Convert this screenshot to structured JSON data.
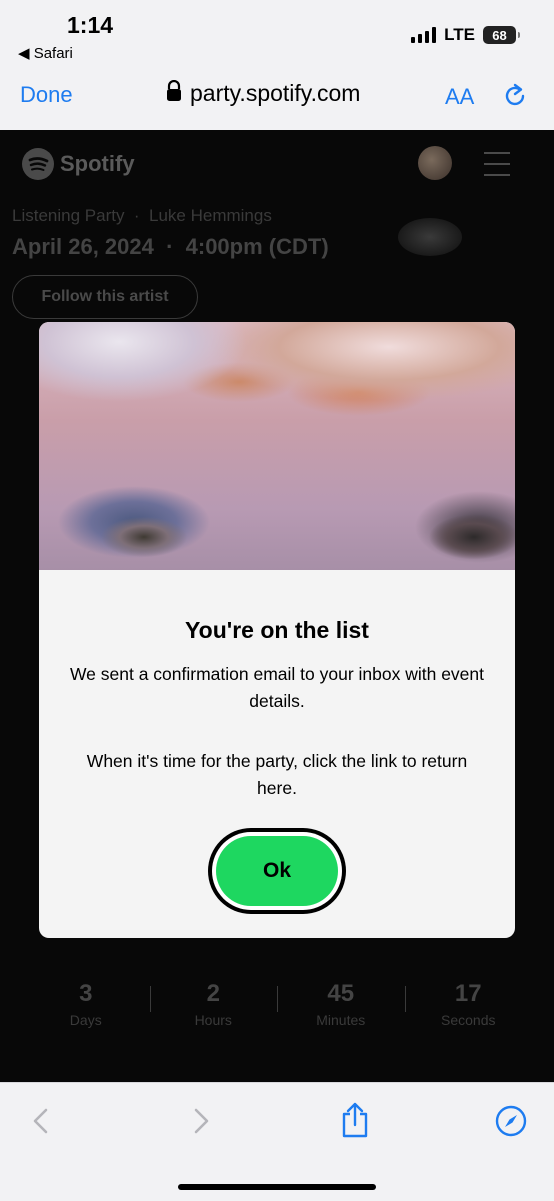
{
  "status_bar": {
    "time": "1:14",
    "back_app": "◀ Safari",
    "network": "LTE",
    "battery": "68"
  },
  "browser": {
    "done_label": "Done",
    "url": "party.spotify.com",
    "text_size_label": "AA"
  },
  "page": {
    "brand": "Spotify",
    "pre_title": "Listening Party  ·  Luke Hemmings",
    "date_line": "April 26, 2024  ·  4:00pm (CDT)",
    "follow_label": "Follow this artist",
    "countdown": [
      {
        "value": "3",
        "label": "Days"
      },
      {
        "value": "2",
        "label": "Hours"
      },
      {
        "value": "45",
        "label": "Minutes"
      },
      {
        "value": "17",
        "label": "Seconds"
      }
    ]
  },
  "modal": {
    "title": "You're on the list",
    "text1": "We sent a confirmation email to your inbox with event details.",
    "text2": "When it's time for the party, click the link to return here.",
    "ok_label": "Ok"
  },
  "colors": {
    "accent_blue": "#1e7cf0",
    "spotify_green": "#1ed760"
  }
}
